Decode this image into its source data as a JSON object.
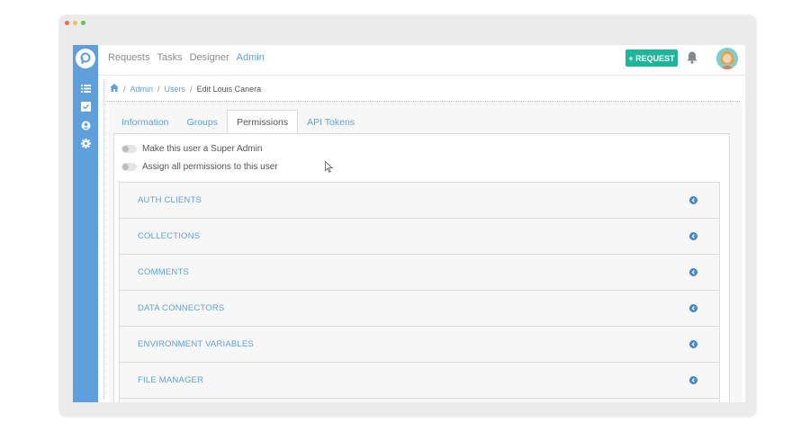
{
  "nav": {
    "items": [
      {
        "label": "Requests",
        "active": false
      },
      {
        "label": "Tasks",
        "active": false
      },
      {
        "label": "Designer",
        "active": false
      },
      {
        "label": "Admin",
        "active": true
      }
    ],
    "request_button": "+ REQUEST"
  },
  "breadcrumb": {
    "admin": "Admin",
    "users": "Users",
    "current": "Edit Louis Canera",
    "separator": "/"
  },
  "tabs": [
    {
      "label": "Information",
      "active": false
    },
    {
      "label": "Groups",
      "active": false
    },
    {
      "label": "Permissions",
      "active": true
    },
    {
      "label": "API Tokens",
      "active": false
    }
  ],
  "toggles": {
    "super_admin": {
      "label": "Make this user a Super Admin",
      "on": false
    },
    "all_permissions": {
      "label": "Assign all permissions to this user",
      "on": false
    }
  },
  "permission_groups": [
    "AUTH CLIENTS",
    "COLLECTIONS",
    "COMMENTS",
    "DATA CONNECTORS",
    "ENVIRONMENT VARIABLES",
    "FILE MANAGER",
    ""
  ],
  "colors": {
    "sidebar": "#5fa0dc",
    "accent": "#5fa0dc",
    "request_button": "#1fb59a"
  },
  "icons": {
    "logo": "processmaker-logo-icon",
    "sidebar": [
      "list-icon",
      "checkbox-icon",
      "user-circle-icon",
      "gear-icon"
    ],
    "bell": "bell-icon",
    "home": "home-icon",
    "row_toggle": "chevron-left-circle-icon"
  }
}
